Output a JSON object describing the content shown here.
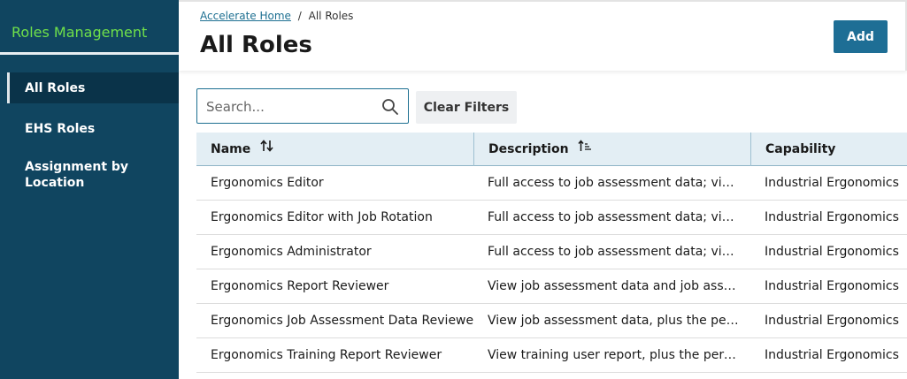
{
  "sidebar": {
    "title": "Roles Management",
    "items": [
      {
        "label": "All Roles",
        "active": true
      },
      {
        "label": "EHS Roles",
        "active": false
      },
      {
        "label": "Assignment by Location",
        "active": false
      }
    ]
  },
  "header": {
    "breadcrumb": {
      "home": "Accelerate Home",
      "separator": "/",
      "current": "All Roles"
    },
    "title": "All Roles",
    "add_label": "Add"
  },
  "filters": {
    "search_placeholder": "Search...",
    "search_value": "",
    "clear_label": "Clear Filters"
  },
  "table": {
    "columns": [
      "Name",
      "Description",
      "Capability"
    ],
    "rows": [
      {
        "name": "Ergonomics Editor",
        "description": "Full access to job assessment data; view job assessment report",
        "capability": "Industrial Ergonomics"
      },
      {
        "name": "Ergonomics Editor with Job Rotation",
        "description": "Full access to job assessment data; view job rotation",
        "capability": "Industrial Ergonomics"
      },
      {
        "name": "Ergonomics Administrator",
        "description": "Full access to job assessment data; view job administration",
        "capability": "Industrial Ergonomics"
      },
      {
        "name": "Ergonomics Report Reviewer",
        "description": "View job assessment data and job assessment reports",
        "capability": "Industrial Ergonomics"
      },
      {
        "name": "Ergonomics Job Assessment Data Reviewer",
        "description": "View job assessment data, plus the permissions",
        "capability": "Industrial Ergonomics"
      },
      {
        "name": "Ergonomics Training Report Reviewer",
        "description": "View training user report, plus the permissions",
        "capability": "Industrial Ergonomics"
      }
    ]
  },
  "colors": {
    "sidebar_bg": "#104560",
    "sidebar_title": "#6fe04a",
    "accent": "#1e6e95",
    "table_header_bg": "#e3eef4"
  }
}
